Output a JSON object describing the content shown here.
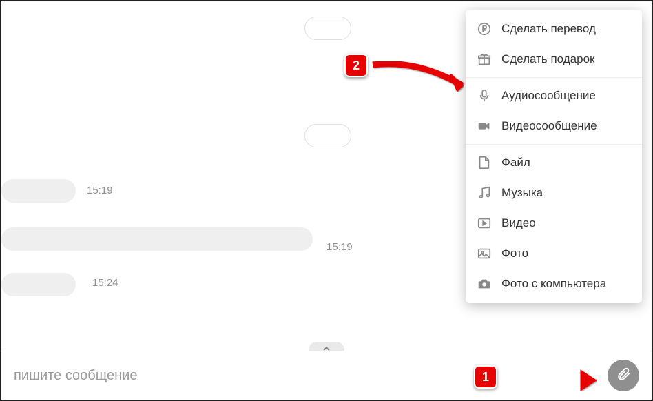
{
  "messages": {
    "time1": "15:19",
    "time2": "15:19",
    "time3": "15:24"
  },
  "input": {
    "placeholder": "пишите сообщение"
  },
  "menu": {
    "transfer": "Сделать перевод",
    "gift": "Сделать подарок",
    "audio": "Аудиосообщение",
    "video_msg": "Видеосообщение",
    "file": "Файл",
    "music": "Музыка",
    "video": "Видео",
    "photo": "Фото",
    "photo_pc": "Фото с компьютера"
  },
  "callouts": {
    "one": "1",
    "two": "2"
  }
}
